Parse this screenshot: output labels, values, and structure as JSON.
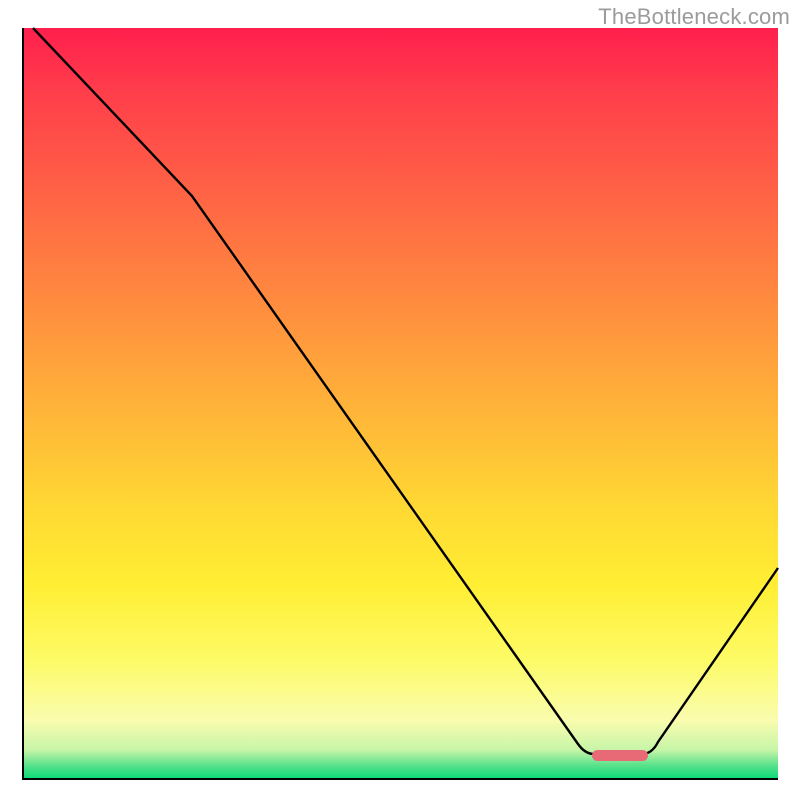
{
  "attribution": "TheBottleneck.com",
  "chart_data": {
    "type": "line",
    "title": "",
    "xlabel": "",
    "ylabel": "",
    "xlim": [
      0,
      1
    ],
    "ylim": [
      0,
      1
    ],
    "background_gradient_stops": [
      {
        "pos": 0.0,
        "color": "#ff1f4d"
      },
      {
        "pos": 0.5,
        "color": "#ffb239"
      },
      {
        "pos": 0.84,
        "color": "#fdfb66"
      },
      {
        "pos": 1.0,
        "color": "#00d976"
      }
    ],
    "series": [
      {
        "name": "bottleneck-curve",
        "x": [
          0.015,
          0.225,
          0.735,
          0.756,
          0.82,
          0.841,
          1.0
        ],
        "values": [
          1.0,
          0.777,
          0.048,
          0.035,
          0.035,
          0.051,
          0.282
        ]
      }
    ],
    "annotations": [
      {
        "name": "optimal-region-marker",
        "shape": "pill",
        "color": "#e96a77",
        "x_start": 0.754,
        "x_end": 0.828,
        "y": 0.032
      }
    ],
    "notes": "No numeric tick labels are visible on either axis; values above are normalized 0–1 estimates read from plot geometry. y=0 corresponds to the green bottom (best / zero bottleneck), y=1 to the red top (worst)."
  }
}
